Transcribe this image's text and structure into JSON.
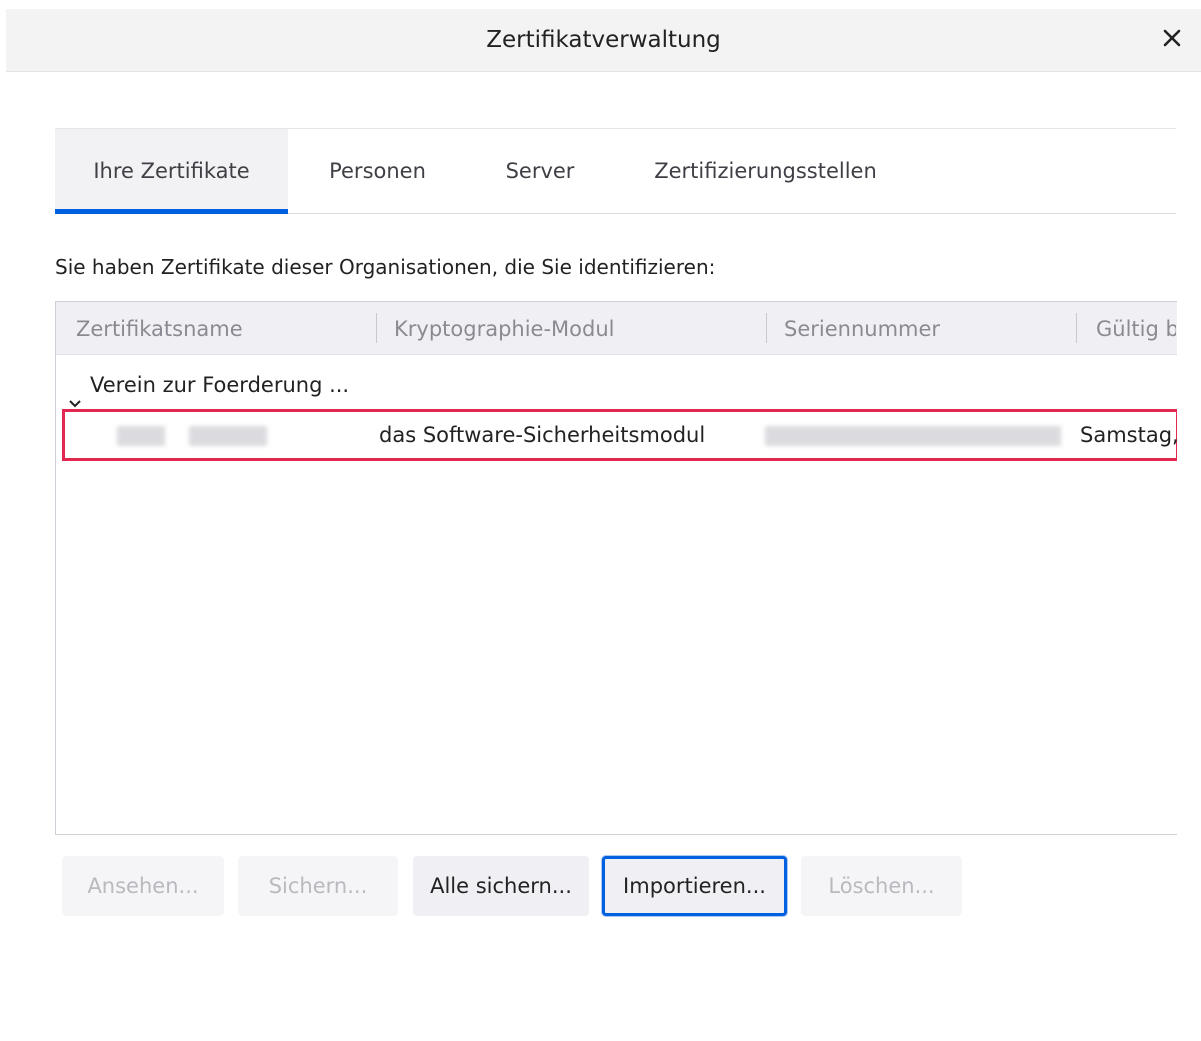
{
  "dialog": {
    "title": "Zertifikatverwaltung",
    "close_icon": "close-icon"
  },
  "tabs": [
    {
      "label": "Ihre Zertifikate",
      "selected": true
    },
    {
      "label": "Personen",
      "selected": false
    },
    {
      "label": "Server",
      "selected": false
    },
    {
      "label": "Zertifizierungsstellen",
      "selected": false
    }
  ],
  "intro_text": "Sie haben Zertifikate dieser Organisationen, die Sie identifizieren:",
  "table": {
    "columns": [
      "Zertifikatsname",
      "Kryptographie-Modul",
      "Seriennummer",
      "Gültig b"
    ],
    "group": {
      "label": "Verein zur Foerderung ...",
      "expanded": true
    },
    "rows": [
      {
        "name": "",
        "module": "das Software-Sicherheitsmodul",
        "serial": "",
        "valid": "Samstag,"
      }
    ]
  },
  "buttons": {
    "view": "Ansehen...",
    "backup": "Sichern...",
    "backup_all": "Alle sichern...",
    "import": "Importieren...",
    "delete": "Löschen..."
  },
  "colors": {
    "accent": "#0061e0",
    "highlight_border": "#e22850"
  }
}
